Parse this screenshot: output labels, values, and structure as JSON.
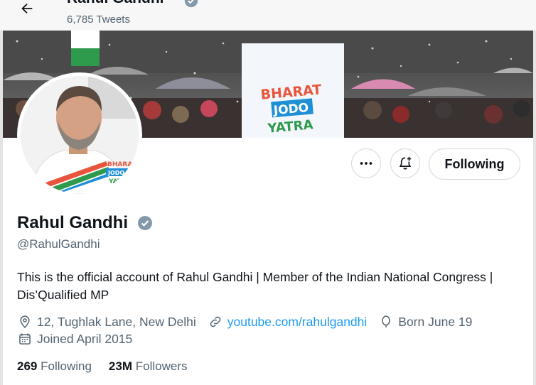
{
  "header": {
    "back_icon": "arrow-left-icon",
    "name": "Rahul Gandhi",
    "tweet_count": "6,785 Tweets"
  },
  "banner": {
    "sign_lines": [
      "BHARAT",
      "JODO",
      "YATRA"
    ]
  },
  "avatar": {
    "badge_lines": [
      "BHARAT",
      "JODO",
      "YATRA"
    ]
  },
  "actions": {
    "more_icon": "more-horizontal-icon",
    "notify_icon": "bell-plus-icon",
    "follow_label": "Following"
  },
  "profile": {
    "name": "Rahul Gandhi",
    "handle": "@RahulGandhi",
    "bio": "This is the official account of Rahul Gandhi | Member of the Indian National Congress | Dis’Qualified MP",
    "location": "12, Tughlak Lane, New Delhi",
    "website": "youtube.com/rahulgandhi",
    "birthday": "Born June 19",
    "joined": "Joined April 2015"
  },
  "stats": {
    "following_count": "269",
    "following_label": "Following",
    "followers_count": "23M",
    "followers_label": "Followers"
  },
  "colors": {
    "link": "#1d9bf0",
    "secondary_text": "#536471",
    "verified": "#829aab"
  }
}
